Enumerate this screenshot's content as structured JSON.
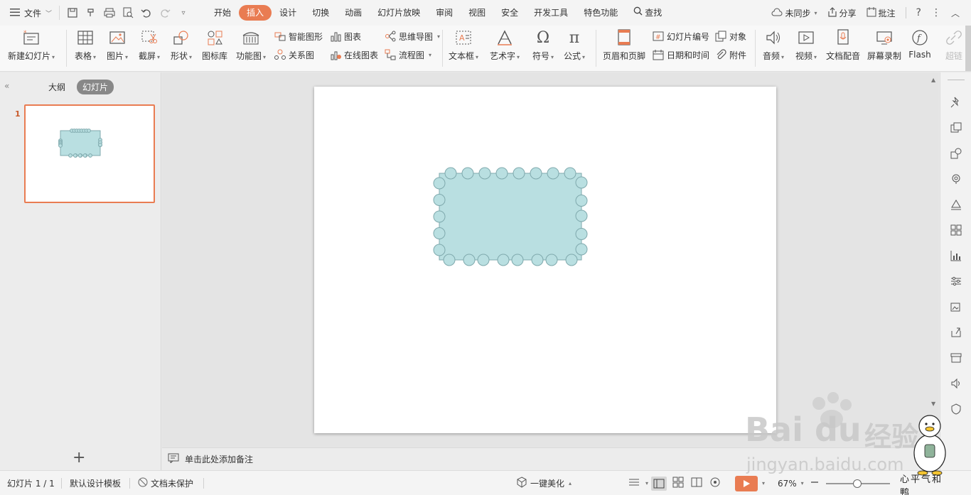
{
  "menubar": {
    "file_label": "文件",
    "tabs": [
      "开始",
      "插入",
      "设计",
      "切换",
      "动画",
      "幻灯片放映",
      "审阅",
      "视图",
      "安全",
      "开发工具",
      "特色功能"
    ],
    "active_tab": "插入",
    "search_label": "查找",
    "sync_label": "未同步",
    "share_label": "分享",
    "comment_label": "批注"
  },
  "ribbon": {
    "new_slide": "新建幻灯片",
    "table": "表格",
    "picture": "图片",
    "screenshot": "截屏",
    "shape": "形状",
    "icon_lib": "图标库",
    "function_chart": "功能图",
    "smart_shape": "智能图形",
    "relation_chart": "关系图",
    "chart": "图表",
    "online_chart": "在线图表",
    "mind_map": "思维导图",
    "flow_chart": "流程图",
    "textbox": "文本框",
    "wordart": "艺术字",
    "symbol": "符号",
    "formula": "公式",
    "header_footer": "页眉和页脚",
    "slide_number": "幻灯片编号",
    "date_time": "日期和时间",
    "object": "对象",
    "attachment": "附件",
    "audio": "音频",
    "video": "视频",
    "doc_voice": "文档配音",
    "screen_record": "屏幕录制",
    "flash": "Flash",
    "hyperlink": "超链"
  },
  "leftpanel": {
    "outline_tab": "大纲",
    "slides_tab": "幻灯片",
    "slide_number": "1",
    "add_glyph": "+"
  },
  "notes": {
    "placeholder": "单击此处添加备注"
  },
  "statusbar": {
    "slide_info": "幻灯片 1 / 1",
    "template": "默认设计模板",
    "protection": "文档未保护",
    "beautify": "一键美化",
    "zoom": "67%"
  },
  "watermark": {
    "brand_latin_1": "Bai",
    "brand_latin_2": "du",
    "brand_cn": "经验",
    "url": "jingyan.baidu.com",
    "signature": "心平气和鸭"
  },
  "shape": {
    "fill": "#b9dfe1",
    "stroke": "#7fa9ad",
    "circle_fill": "#b9dfe1"
  },
  "colors": {
    "accent": "#e97c52"
  }
}
